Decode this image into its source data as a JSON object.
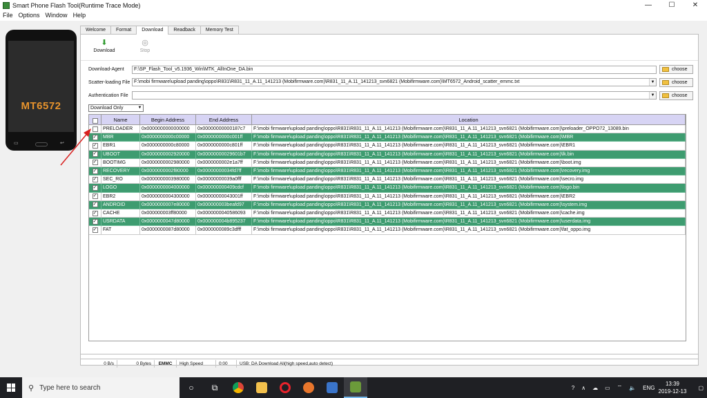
{
  "window": {
    "title": "Smart Phone Flash Tool(Runtime Trace Mode)",
    "controls": {
      "minimize": "—",
      "maximize": "☐",
      "close": "✕"
    }
  },
  "menu": [
    "File",
    "Options",
    "Window",
    "Help"
  ],
  "phone": {
    "model": "MT6572"
  },
  "tabs": [
    "Welcome",
    "Format",
    "Download",
    "Readback",
    "Memory Test"
  ],
  "active_tab": "Download",
  "toolbar": {
    "download_label": "Download",
    "stop_label": "Stop"
  },
  "fields": {
    "download_agent": {
      "label": "Download-Agent",
      "value": "F:\\SP_Flash_Tool_v5.1936_Win\\MTK_AllInOne_DA.bin"
    },
    "scatter_file": {
      "label": "Scatter-loading File",
      "value": "F:\\mobi firmware\\upload panding\\oppo\\R831\\R831_11_A.11_141213 (Mobifirmware.com)\\R831_11_A.11_141213_svn6821 (Mobifirmware.com)\\MT6572_Android_scatter_emmc.txt"
    },
    "authentication_file": {
      "label": "Authentication File",
      "value": ""
    },
    "choose_label": "choose"
  },
  "mode_select": {
    "selected": "Download Only"
  },
  "table": {
    "headers": {
      "name": "Name",
      "begin": "Begin Address",
      "end": "End Address",
      "location": "Location"
    },
    "rows": [
      {
        "checked": false,
        "green": false,
        "name": "PRELOADER",
        "begin": "0x0000000000000000",
        "end": "0x00000000000187c7",
        "location": "F:\\mobi firmware\\upload panding\\oppo\\R831\\R831_11_A.11_141213 (Mobifirmware.com)\\R831_11_A.11_141213_svn6821 (Mobifirmware.com)\\preloader_OPPO72_13089.bin"
      },
      {
        "checked": true,
        "green": true,
        "name": "MBR",
        "begin": "0x0000000000c00000",
        "end": "0x0000000000c001ff",
        "location": "F:\\mobi firmware\\upload panding\\oppo\\R831\\R831_11_A.11_141213 (Mobifirmware.com)\\R831_11_A.11_141213_svn6821 (Mobifirmware.com)\\MBR"
      },
      {
        "checked": true,
        "green": false,
        "name": "EBR1",
        "begin": "0x0000000000c80000",
        "end": "0x0000000000c801ff",
        "location": "F:\\mobi firmware\\upload panding\\oppo\\R831\\R831_11_A.11_141213 (Mobifirmware.com)\\R831_11_A.11_141213_svn6821 (Mobifirmware.com)\\EBR1"
      },
      {
        "checked": true,
        "green": true,
        "name": "UBOOT",
        "begin": "0x0000000002920000",
        "end": "0x00000000029601b7",
        "location": "F:\\mobi firmware\\upload panding\\oppo\\R831\\R831_11_A.11_141213 (Mobifirmware.com)\\R831_11_A.11_141213_svn6821 (Mobifirmware.com)\\lk.bin"
      },
      {
        "checked": true,
        "green": false,
        "name": "BOOTIMG",
        "begin": "0x0000000002980000",
        "end": "0x0000000002e1a7ff",
        "location": "F:\\mobi firmware\\upload panding\\oppo\\R831\\R831_11_A.11_141213 (Mobifirmware.com)\\R831_11_A.11_141213_svn6821 (Mobifirmware.com)\\boot.img"
      },
      {
        "checked": true,
        "green": true,
        "name": "RECOVERY",
        "begin": "0x0000000002f80000",
        "end": "0x00000000034fd7ff",
        "location": "F:\\mobi firmware\\upload panding\\oppo\\R831\\R831_11_A.11_141213 (Mobifirmware.com)\\R831_11_A.11_141213_svn6821 (Mobifirmware.com)\\recovery.img"
      },
      {
        "checked": true,
        "green": false,
        "name": "SEC_RO",
        "begin": "0x0000000003980000",
        "end": "0x00000000039a0fff",
        "location": "F:\\mobi firmware\\upload panding\\oppo\\R831\\R831_11_A.11_141213 (Mobifirmware.com)\\R831_11_A.11_141213_svn6821 (Mobifirmware.com)\\secro.img"
      },
      {
        "checked": true,
        "green": true,
        "name": "LOGO",
        "begin": "0x0000000004000000",
        "end": "0x000000000409cdcf",
        "location": "F:\\mobi firmware\\upload panding\\oppo\\R831\\R831_11_A.11_141213 (Mobifirmware.com)\\R831_11_A.11_141213_svn6821 (Mobifirmware.com)\\logo.bin"
      },
      {
        "checked": true,
        "green": false,
        "name": "EBR2",
        "begin": "0x0000000004300000",
        "end": "0x00000000043001ff",
        "location": "F:\\mobi firmware\\upload panding\\oppo\\R831\\R831_11_A.11_141213 (Mobifirmware.com)\\R831_11_A.11_141213_svn6821 (Mobifirmware.com)\\EBR2"
      },
      {
        "checked": true,
        "green": true,
        "name": "ANDROID",
        "begin": "0x0000000007e80000",
        "end": "0x000000003beafd97",
        "location": "F:\\mobi firmware\\upload panding\\oppo\\R831\\R831_11_A.11_141213 (Mobifirmware.com)\\R831_11_A.11_141213_svn6821 (Mobifirmware.com)\\system.img"
      },
      {
        "checked": true,
        "green": false,
        "name": "CACHE",
        "begin": "0x000000003ff80000",
        "end": "0x0000000040586093",
        "location": "F:\\mobi firmware\\upload panding\\oppo\\R831\\R831_11_A.11_141213 (Mobifirmware.com)\\R831_11_A.11_141213_svn6821 (Mobifirmware.com)\\cache.img"
      },
      {
        "checked": true,
        "green": true,
        "name": "USRDATA",
        "begin": "0x0000000047d80000",
        "end": "0x000000004b895237",
        "location": "F:\\mobi firmware\\upload panding\\oppo\\R831\\R831_11_A.11_141213 (Mobifirmware.com)\\R831_11_A.11_141213_svn6821 (Mobifirmware.com)\\userdata.img"
      },
      {
        "checked": true,
        "green": false,
        "name": "FAT",
        "begin": "0x0000000087d80000",
        "end": "0x0000000089c3dfff",
        "location": "F:\\mobi firmware\\upload panding\\oppo\\R831\\R831_11_A.11_141213 (Mobifirmware.com)\\R831_11_A.11_141213_svn6821 (Mobifirmware.com)\\fat_oppo.img"
      }
    ]
  },
  "status": {
    "speed": "0 B/s",
    "bytes": "0 Bytes",
    "storage": "EMMC",
    "usb_speed": "High Speed",
    "time": "0:00",
    "usb_info": "USB: DA Download All(high speed,auto detect)"
  },
  "taskbar": {
    "search_placeholder": "Type here to search",
    "language": "ENG",
    "time": "13:39",
    "date": "2019-12-13"
  },
  "colors": {
    "row_green": "#3e9c70",
    "header_bg": "#d7d4f4",
    "annotation_arrow": "#d9201f"
  }
}
